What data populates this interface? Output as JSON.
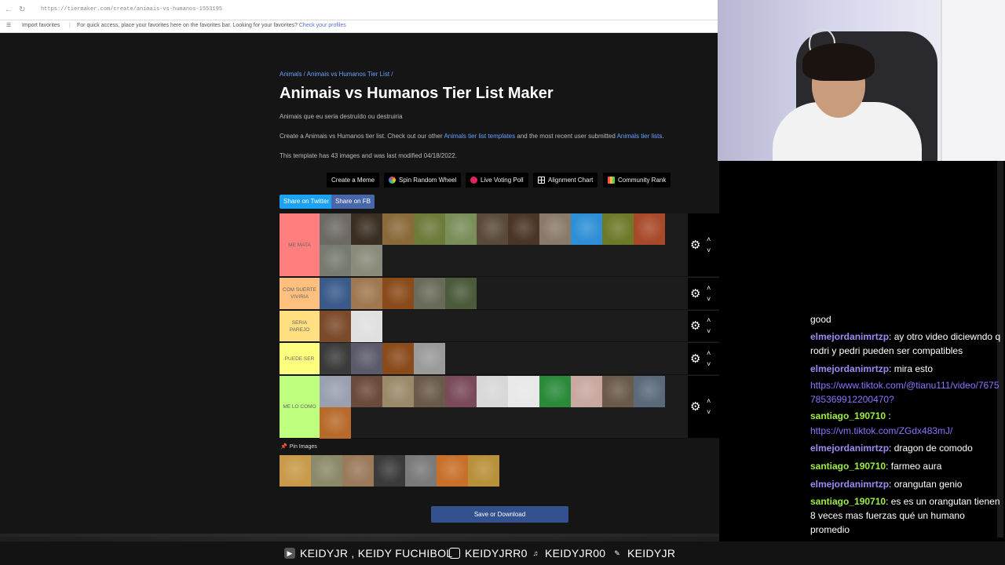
{
  "browser": {
    "url": "https://tiermaker.com/create/animais-vs-humanos-1553195",
    "favorites_import": "Import favorites",
    "favorites_message": "For quick access, place your favorites here on the favorites bar. Looking for your favorites?",
    "favorites_link": "Check your profiles"
  },
  "page": {
    "breadcrumb": "Animals / Animais vs Humanos Tier List /",
    "title": "Animais vs Humanos Tier List Maker",
    "subtitle": "Animais que eu seria destruído ou destruiria",
    "desc_pre": "Create a Animais vs Humanos tier list. Check out our other",
    "desc_link1": "Animals tier list templates",
    "desc_mid": "and the most recent user submitted",
    "desc_link2": "Animals tier lists",
    "desc_post": ".",
    "meta": "This template has 43 images and was last modified 04/18/2022.",
    "buttons": [
      {
        "label": "Create a Meme",
        "icon": ""
      },
      {
        "label": "Spin Random Wheel",
        "icon": "wheel-icon"
      },
      {
        "label": "Live Voting Poll",
        "icon": "poll-icon"
      },
      {
        "label": "Alignment Chart",
        "icon": "grid-icon"
      },
      {
        "label": "Community Rank",
        "icon": "rank-icon"
      }
    ],
    "share_twitter": "Share on Twitter",
    "share_fb": "Share on FB",
    "pin_label": "Pin Images",
    "save_label": "Save or Download",
    "tiers": [
      {
        "label": "ME MATA",
        "color": "#ff7f7f",
        "rows": 2,
        "images": 14,
        "colors": [
          "#6d6a66",
          "#3a2e22",
          "#8a6a3a",
          "#6c7a3a",
          "#7a8e5a",
          "#5a4a3a",
          "#4a3526",
          "#8a7a6a",
          "#2e8fd6",
          "#6e7a2a",
          "#a84a2a",
          "#777a70",
          "#8a8a7a"
        ]
      },
      {
        "label": "COM SUERTE VIVIRIA",
        "color": "#ffbf7f",
        "rows": 1,
        "images": 5,
        "colors": [
          "#3a5a8a",
          "#a07850",
          "#8a4a1a",
          "#6a6a5a",
          "#4a5a3a"
        ]
      },
      {
        "label": "SERIA PAREJO",
        "color": "#ffdf7f",
        "rows": 1,
        "images": 2,
        "colors": [
          "#7a4a2a",
          "#e0e0e0"
        ]
      },
      {
        "label": "PUEDE SER",
        "color": "#ffff7f",
        "rows": 1,
        "images": 4,
        "colors": [
          "#3a3a3a",
          "#5a5a6a",
          "#8a4a1a",
          "#9a9a9a"
        ]
      },
      {
        "label": "ME LO COMO",
        "color": "#bfff7f",
        "rows": 2,
        "images": 12,
        "colors": [
          "#9aa0b0",
          "#6a4a3a",
          "#9a8a6a",
          "#6a5a4a",
          "#7a4a5a",
          "#d8d8d8",
          "#e8e8e8",
          "#2a8a3a",
          "#c8a8a0",
          "#6a5a4a",
          "#5a6a7a",
          "#b86a2a"
        ]
      }
    ],
    "pin_colors": [
      "#c89a4a",
      "#8a8a6a",
      "#9a7a5a",
      "#3a3a3a",
      "#7a7a7a",
      "#c8702a",
      "#b8903a"
    ]
  },
  "chat": {
    "messages": [
      {
        "user": "",
        "text": "good",
        "kind": "plain"
      },
      {
        "user": "elmejordanimrtzp",
        "text": ": ay otro video diciewndo q rodri y pedri pueden ser compatibles",
        "kind": "u1"
      },
      {
        "user": "elmejordanimrtzp",
        "text": ": mira esto",
        "kind": "u1"
      },
      {
        "user": "",
        "text": "https://www.tiktok.com/@tianu111/video/7675785369912200470?",
        "kind": "link"
      },
      {
        "user": "santiago_190710",
        "text": " :",
        "kind": "u2"
      },
      {
        "user": "",
        "text": "https://vm.tiktok.com/ZGdx483mJ/",
        "kind": "link"
      },
      {
        "user": "elmejordanimrtzp",
        "text": ": dragon de comodo",
        "kind": "u1"
      },
      {
        "user": "santiago_190710",
        "text": ": farmeo aura",
        "kind": "u2"
      },
      {
        "user": "elmejordanimrtzp",
        "text": ": orangutan genio",
        "kind": "u1"
      },
      {
        "user": "santiago_190710",
        "text": ": es es un orangutan tienen 8 veces mas fuerzas qué un humano promedio",
        "kind": "u2"
      }
    ]
  },
  "bottom": {
    "s1": "KEIDYJR , KEIDY FUCHIBOL",
    "s2": "KEIDYJRR0",
    "s3": "KEIDYJR00",
    "s4": "KEIDYJR"
  }
}
